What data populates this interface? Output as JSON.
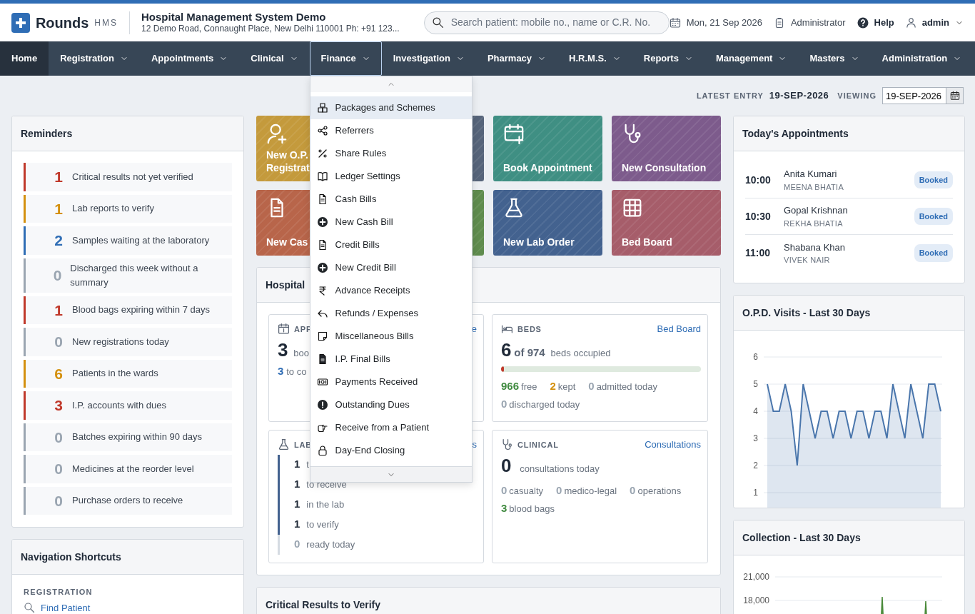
{
  "header": {
    "brand": "Rounds",
    "brand_suffix": "HMS",
    "org_name": "Hospital Management System Demo",
    "org_address": "12 Demo Road, Connaught Place, New Delhi 110001 Ph: +91 123...",
    "search": {
      "placeholder": "Search patient: mobile no., name or C.R. No."
    },
    "date": "Mon, 21 Sep 2026",
    "role": "Administrator",
    "help": "Help",
    "user": "admin"
  },
  "nav": [
    {
      "label": "Home",
      "selected": true,
      "expanded": false,
      "caret": false
    },
    {
      "label": "Registration",
      "selected": false,
      "expanded": false,
      "caret": true
    },
    {
      "label": "Appointments",
      "selected": false,
      "expanded": false,
      "caret": true
    },
    {
      "label": "Clinical",
      "selected": false,
      "expanded": false,
      "caret": true
    },
    {
      "label": "Finance",
      "selected": false,
      "expanded": true,
      "caret": true
    },
    {
      "label": "Investigation",
      "selected": false,
      "expanded": false,
      "caret": true
    },
    {
      "label": "Pharmacy",
      "selected": false,
      "expanded": false,
      "caret": true
    },
    {
      "label": "H.R.M.S.",
      "selected": false,
      "expanded": false,
      "caret": true
    },
    {
      "label": "Reports",
      "selected": false,
      "expanded": false,
      "caret": true
    },
    {
      "label": "Management",
      "selected": false,
      "expanded": false,
      "caret": true
    },
    {
      "label": "Masters",
      "selected": false,
      "expanded": false,
      "caret": true
    },
    {
      "label": "Administration",
      "selected": false,
      "expanded": false,
      "caret": true
    }
  ],
  "finance_menu": {
    "items": [
      {
        "label": "Packages and Schemes",
        "selected": true
      },
      {
        "label": "Referrers",
        "selected": false
      },
      {
        "label": "Share Rules",
        "selected": false
      },
      {
        "label": "Ledger Settings",
        "selected": false
      },
      {
        "label": "Cash Bills",
        "selected": false
      },
      {
        "label": "New Cash Bill",
        "selected": false
      },
      {
        "label": "Credit Bills",
        "selected": false
      },
      {
        "label": "New Credit Bill",
        "selected": false
      },
      {
        "label": "Advance Receipts",
        "selected": false
      },
      {
        "label": "Refunds / Expenses",
        "selected": false
      },
      {
        "label": "Miscellaneous Bills",
        "selected": false
      },
      {
        "label": "I.P. Final Bills",
        "selected": false
      },
      {
        "label": "Payments Received",
        "selected": false
      },
      {
        "label": "Outstanding Dues",
        "selected": false
      },
      {
        "label": "Receive from a Patient",
        "selected": false
      },
      {
        "label": "Day-End Closing",
        "selected": false
      }
    ]
  },
  "date_bar": {
    "latest_label": "LATEST ENTRY",
    "latest_value": "19-SEP-2026",
    "viewing_label": "VIEWING",
    "viewing_value": "19-SEP-2026"
  },
  "reminders": {
    "title": "Reminders",
    "items": [
      {
        "count": "1",
        "text": "Critical results not yet verified",
        "color": "#c0392b"
      },
      {
        "count": "1",
        "text": "Lab reports to verify",
        "color": "#d4900f"
      },
      {
        "count": "2",
        "text": "Samples waiting at the laboratory",
        "color": "#2f6db5"
      },
      {
        "count": "0",
        "text": "Discharged this week without a summary",
        "color": "#9aa5b1"
      },
      {
        "count": "1",
        "text": "Blood bags expiring within 7 days",
        "color": "#c0392b"
      },
      {
        "count": "0",
        "text": "New registrations today",
        "color": "#9aa5b1"
      },
      {
        "count": "6",
        "text": "Patients in the wards",
        "color": "#d4900f"
      },
      {
        "count": "3",
        "text": "I.P. accounts with dues",
        "color": "#c0392b"
      },
      {
        "count": "0",
        "text": "Batches expiring within 90 days",
        "color": "#9aa5b1"
      },
      {
        "count": "0",
        "text": "Medicines at the reorder level",
        "color": "#9aa5b1"
      },
      {
        "count": "0",
        "text": "Purchase orders to receive",
        "color": "#9aa5b1"
      }
    ]
  },
  "shortcuts": {
    "title": "Navigation Shortcuts",
    "sections": [
      {
        "heading": "REGISTRATION",
        "links": [
          "Find Patient"
        ]
      }
    ]
  },
  "tiles": [
    {
      "label": "New O.P. Registrat",
      "color": "#c49a3c"
    },
    {
      "color": "#56647a"
    },
    {
      "label": "Book Appointment",
      "color": "#3f8f83"
    },
    {
      "label": "New Consultation",
      "color": "#7d5b8c"
    },
    {
      "label": "New Cas",
      "color": "#b8654a"
    },
    {
      "color": "#5f8c4e"
    },
    {
      "label": "New Lab Order",
      "color": "#43628f"
    },
    {
      "label": "Bed Board",
      "color": "#a65d6a"
    }
  ],
  "hospital_panel": {
    "title": "Hospital",
    "appointments_card": {
      "heading": "APP",
      "link": "e",
      "big_value": "3",
      "big_label": "boo",
      "sub_value": "3",
      "sub_label": "to co"
    },
    "beds_card": {
      "heading": "BEDS",
      "link": "Bed Board",
      "big_value": "6",
      "big_of": "of 974",
      "big_label": "beds occupied",
      "level": 0.006,
      "stats": [
        {
          "count": "966",
          "text": "free",
          "color": "#3f8a3f"
        },
        {
          "count": "2",
          "text": "kept",
          "color": "#d4900f"
        },
        {
          "count": "0",
          "text": "admitted today",
          "color": "#9aa5b1"
        },
        {
          "count": "0",
          "text": "discharged today",
          "color": "#9aa5b1"
        }
      ]
    },
    "lab_card": {
      "heading": "LAB",
      "link": "s",
      "rows": [
        {
          "value": "1",
          "label": "t",
          "color": "#43628f"
        },
        {
          "value": "1",
          "label": "to receive",
          "color": "#43628f"
        },
        {
          "value": "1",
          "label": "in the lab",
          "color": "#43628f"
        },
        {
          "value": "1",
          "label": "to verify",
          "color": "#43628f"
        },
        {
          "value": "0",
          "label": "ready today",
          "color": "#d5dbe2"
        }
      ]
    },
    "clinical_card": {
      "heading": "CLINICAL",
      "link": "Consultations",
      "big_value": "0",
      "big_label": "consultations today",
      "stats": [
        {
          "count": "0",
          "text": "casualty",
          "color": "#9aa5b1"
        },
        {
          "count": "0",
          "text": "medico-legal",
          "color": "#9aa5b1"
        },
        {
          "count": "0",
          "text": "operations",
          "color": "#9aa5b1"
        },
        {
          "count": "3",
          "text": "blood bags",
          "color": "#3f8a3f"
        }
      ]
    }
  },
  "critical_panel": {
    "title": "Critical Results to Verify"
  },
  "todays_appointments": {
    "title": "Today's Appointments",
    "items": [
      {
        "time": "10:00",
        "patient": "Anita Kumari",
        "doctor": "MEENA BHATIA",
        "status": "Booked"
      },
      {
        "time": "10:30",
        "patient": "Gopal Krishnan",
        "doctor": "REKHA BHATIA",
        "status": "Booked"
      },
      {
        "time": "11:00",
        "patient": "Shabana Khan",
        "doctor": "VIVEK NAIR",
        "status": "Booked"
      }
    ]
  },
  "opd_chart": {
    "title": "O.P.D. Visits - Last 30 Days",
    "chart_data": {
      "type": "area",
      "grid": true,
      "ylim": [
        1,
        6
      ],
      "yticks": [
        1,
        2,
        3,
        4,
        5,
        6
      ],
      "series": [
        {
          "color": "#4a76ac",
          "values": [
            5,
            4,
            4,
            5,
            4,
            2,
            5,
            4,
            3,
            4,
            4,
            3,
            4,
            4,
            3,
            4,
            4,
            3,
            4,
            4,
            3,
            5,
            4,
            3,
            5,
            4,
            3,
            5,
            5,
            4
          ]
        }
      ]
    }
  },
  "collection_chart": {
    "title": "Collection - Last 30 Days",
    "y_labels": [
      "21,000",
      "18,000"
    ]
  }
}
